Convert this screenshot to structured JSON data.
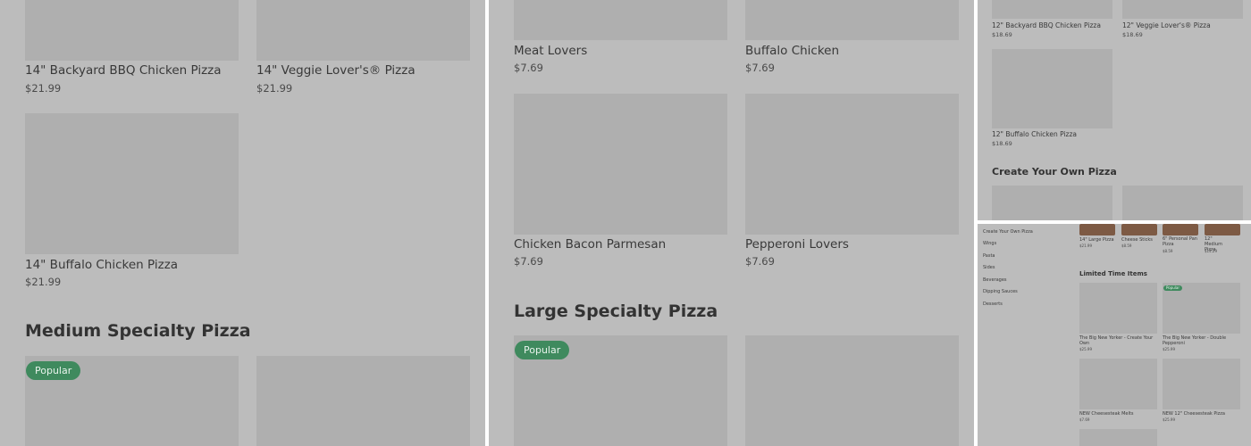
{
  "panel1": {
    "items": [
      {
        "name": "14\" Backyard BBQ Chicken Pizza",
        "price": "$21.99"
      },
      {
        "name": "14\" Veggie Lover's® Pizza",
        "price": "$21.99"
      },
      {
        "name": "14\" Buffalo Chicken Pizza",
        "price": "$21.99"
      }
    ],
    "section_title": "Medium Specialty Pizza",
    "badge": "Popular"
  },
  "panel2": {
    "items": [
      {
        "name": "Meat Lovers",
        "price": "$7.69"
      },
      {
        "name": "Buffalo Chicken",
        "price": "$7.69"
      },
      {
        "name": "Chicken Bacon Parmesan",
        "price": "$7.69"
      },
      {
        "name": "Pepperoni Lovers",
        "price": "$7.69"
      }
    ],
    "section_title": "Large Specialty Pizza",
    "badge": "Popular"
  },
  "panel3": {
    "items": [
      {
        "name": "12\" Backyard BBQ Chicken Pizza",
        "price": "$18.69"
      },
      {
        "name": "12\" Veggie Lover's® Pizza",
        "price": "$18.69"
      },
      {
        "name": "12\" Buffalo Chicken Pizza",
        "price": "$18.69"
      }
    ],
    "section_title": "Create Your Own Pizza"
  },
  "panel4": {
    "sidebar": [
      "Create Your Own Pizza",
      "Wings",
      "Pasta",
      "Sides",
      "Beverages",
      "Dipping Sauces",
      "Desserts"
    ],
    "top_items": [
      {
        "name": "14\" Large Pizza",
        "price": "$21.99"
      },
      {
        "name": "Cheese Sticks",
        "price": "$8.59"
      },
      {
        "name": "6\" Personal Pan Pizza",
        "price": "$8.59"
      },
      {
        "name": "12\" Medium Pizza",
        "price": "$14.29"
      }
    ],
    "section_title": "Limited Time Items",
    "badge": "Popular",
    "items": [
      {
        "name": "The Big New Yorker - Create Your Own",
        "price": "$25.99"
      },
      {
        "name": "The Big New Yorker - Double Pepperoni",
        "price": "$25.99"
      },
      {
        "name": "NEW Cheesesteak Melts",
        "price": "$7.69"
      },
      {
        "name": "NEW 12\" Cheesesteak Pizza",
        "price": "$25.99"
      }
    ]
  }
}
